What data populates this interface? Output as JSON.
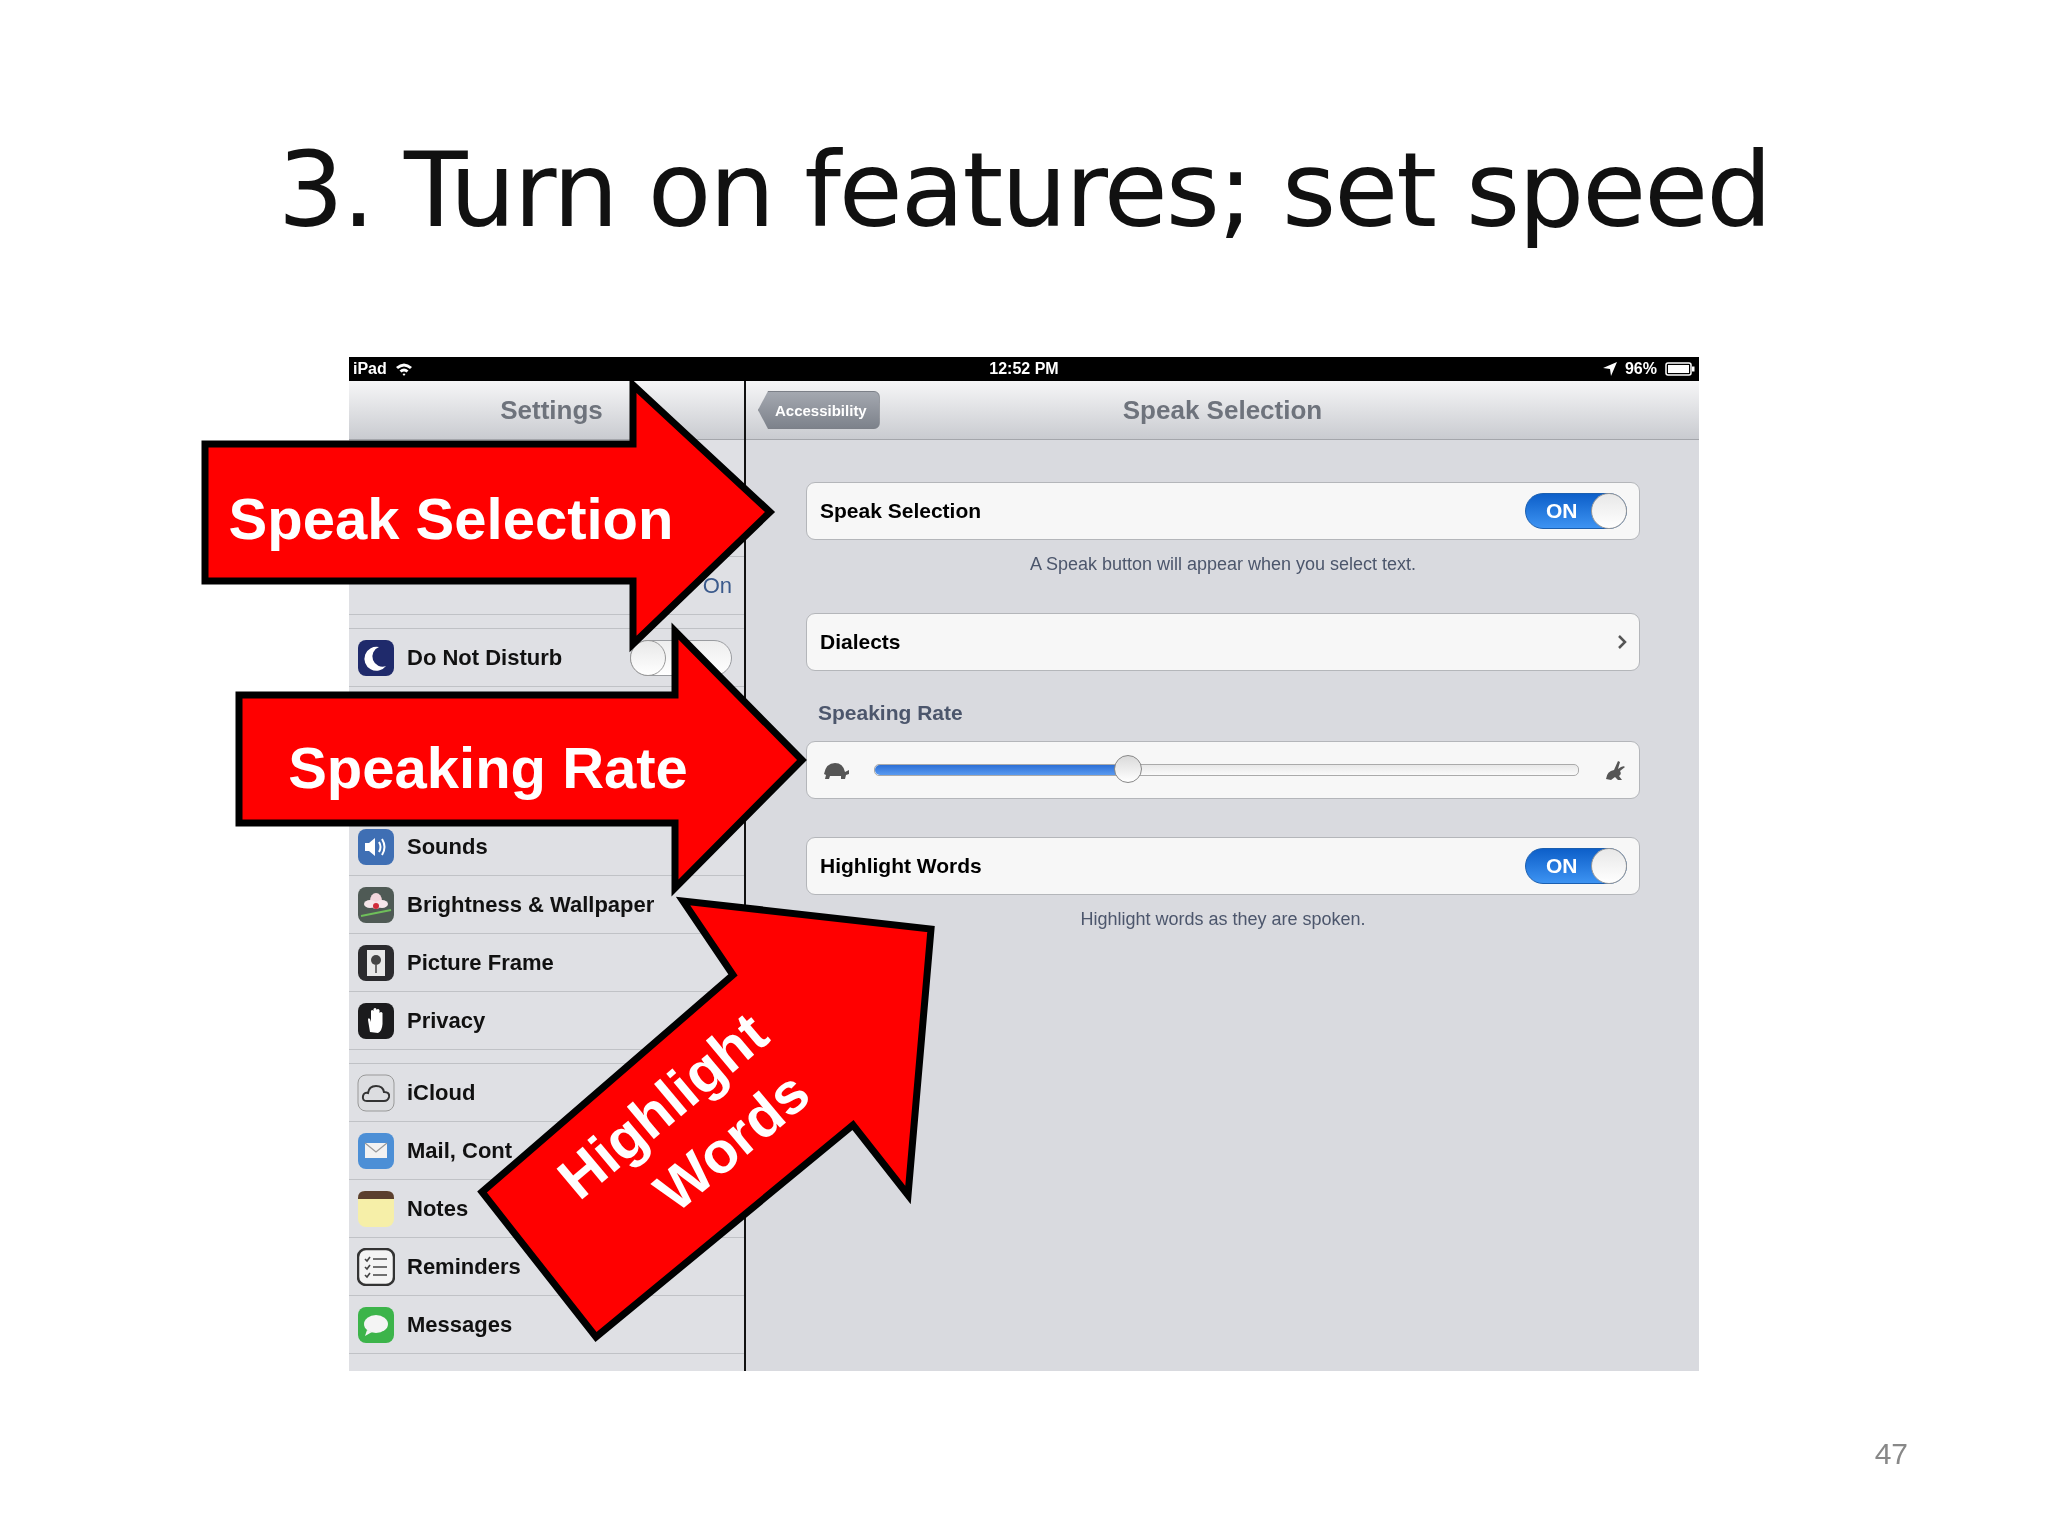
{
  "slide": {
    "title": "3. Turn on features; set speed",
    "page_number": "47"
  },
  "status_bar": {
    "device": "iPad",
    "time": "12:52 PM",
    "battery": "96%"
  },
  "sidebar": {
    "title": "Settings",
    "groups": [
      {
        "items": [
          {
            "value": "On"
          }
        ]
      },
      {
        "items": [
          {
            "label": "Do Not Disturb",
            "kind": "toggle",
            "on": false
          }
        ]
      },
      {
        "items": [
          {
            "label": "Sounds"
          },
          {
            "label": "Brightness & Wallpaper"
          },
          {
            "label": "Picture Frame"
          },
          {
            "label": "Privacy"
          }
        ]
      },
      {
        "items": [
          {
            "label": "iCloud"
          },
          {
            "label": "Mail, Cont"
          },
          {
            "label": "Notes"
          },
          {
            "label": "Reminders"
          },
          {
            "label": "Messages"
          }
        ]
      }
    ]
  },
  "detail": {
    "back_button": "Accessibility",
    "title": "Speak Selection",
    "sections": [
      {
        "kind": "toggle",
        "label": "Speak Selection",
        "on": true,
        "state_text": "ON",
        "footer": "A Speak button will appear when you select text."
      },
      {
        "kind": "link",
        "label": "Dialects"
      },
      {
        "kind": "slider",
        "header": "Speaking Rate",
        "level": 0.36
      },
      {
        "kind": "toggle",
        "label": "Highlight Words",
        "on": true,
        "state_text": "ON",
        "footer": "Highlight words as they are spoken."
      }
    ]
  },
  "callouts": [
    {
      "lines": [
        "Speak Selection"
      ]
    },
    {
      "lines": [
        "Speaking Rate"
      ]
    },
    {
      "lines": [
        "Highlight",
        "Words"
      ]
    }
  ]
}
